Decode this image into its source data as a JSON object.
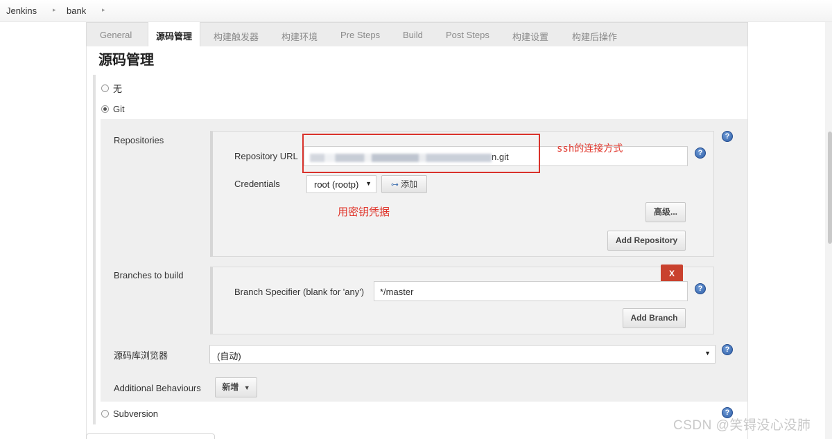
{
  "breadcrumb": {
    "items": [
      "Jenkins",
      "bank"
    ],
    "separator": "▸"
  },
  "tabs": [
    "General",
    "源码管理",
    "构建触发器",
    "构建环境",
    "Pre Steps",
    "Build",
    "Post Steps",
    "构建设置",
    "构建后操作"
  ],
  "active_tab": "源码管理",
  "section_title": "源码管理",
  "scm_options": {
    "none": "无",
    "git": "Git",
    "subversion": "Subversion",
    "selected": "Git"
  },
  "repositories": {
    "label": "Repositories",
    "url_label": "Repository URL",
    "url_value_suffix": "n.git",
    "credentials_label": "Credentials",
    "credentials_value": "root (rootp)",
    "add_button": "添加",
    "advanced_button": "高级...",
    "add_repository_button": "Add Repository"
  },
  "branches": {
    "label": "Branches to build",
    "specifier_label": "Branch Specifier (blank for 'any')",
    "specifier_value": "*/master",
    "delete_button": "X",
    "add_branch_button": "Add Branch"
  },
  "browser": {
    "label": "源码库浏览器",
    "value": "(自动)"
  },
  "behaviours": {
    "label": "Additional Behaviours",
    "button": "新增"
  },
  "annotations": {
    "ssh_note": "ssh的连接方式",
    "key_note": "用密钥凭据"
  },
  "help_icon": "?",
  "watermark": "CSDN @笑锝没心没肺",
  "colors": {
    "annotation_red": "#e0352b",
    "delete_red": "#c9412e",
    "help_blue": "#2f5fa8"
  }
}
